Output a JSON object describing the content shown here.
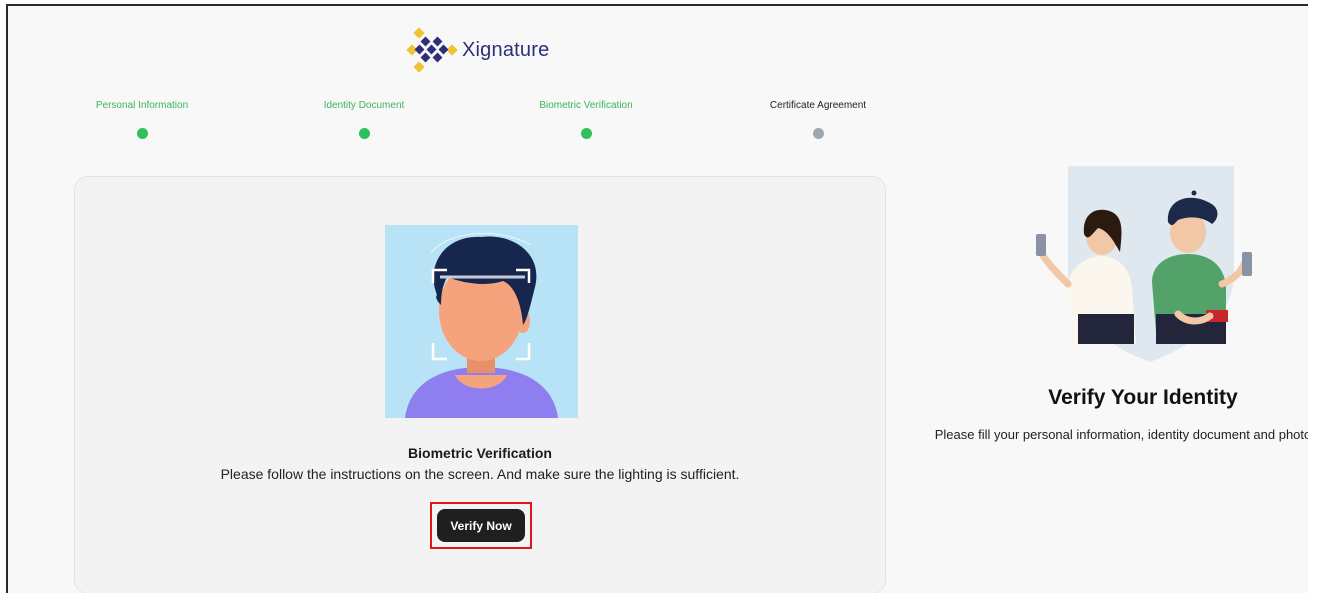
{
  "brand": {
    "name": "Xignature",
    "colors": {
      "navy": "#2d2f7a",
      "gold": "#f2c233"
    }
  },
  "stepper": {
    "steps": [
      {
        "label": "Personal Information",
        "status": "complete"
      },
      {
        "label": "Identity Document",
        "status": "complete"
      },
      {
        "label": "Biometric Verification",
        "status": "complete"
      },
      {
        "label": "Certificate Agreement",
        "status": "pending"
      }
    ],
    "colors": {
      "complete": "#2ec05a",
      "pending": "#a0a6b0"
    }
  },
  "main": {
    "illustration_icon": "face-scan-illustration",
    "title": "Biometric Verification",
    "description": "Please follow the instructions on the screen. And make sure the lighting is sufficient.",
    "verify_button_label": "Verify Now"
  },
  "side": {
    "illustration_icon": "identity-verification-illustration",
    "title": "Verify Your Identity",
    "description": "Please fill your personal information, identity document and photo"
  }
}
